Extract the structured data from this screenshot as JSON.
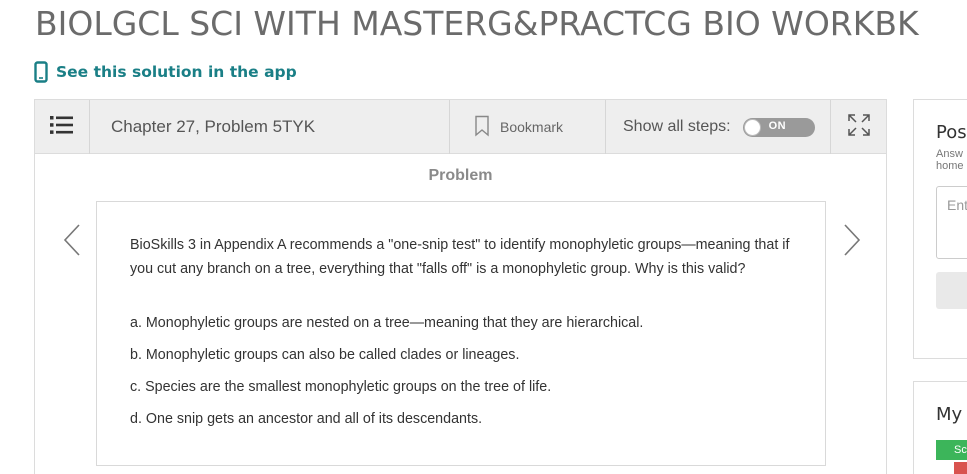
{
  "page": {
    "book_title": "BIOLGCL SCI WITH MASTERG&PRACTCG BIO WORKBK",
    "app_link_label": "See this solution in the app"
  },
  "toolbar": {
    "chapter_label": "Chapter 27, Problem 5TYK",
    "bookmark_label": "Bookmark",
    "show_steps_label": "Show all steps:",
    "toggle_state": "ON"
  },
  "problem": {
    "heading": "Problem",
    "question": "BioSkills 3 in Appendix A recommends a \"one-snip test\" to identify monophyletic groups—meaning that if you cut any branch on a tree, everything that \"falls off\" is a monophyletic group. Why is this valid?",
    "choices": [
      "a. Monophyletic groups are nested on a tree—meaning that they are hierarchical.",
      "b. Monophyletic groups can also be called clades or lineages.",
      "c. Species are the smallest monophyletic groups on the tree of life.",
      "d. One snip gets an ancestor and all of its descendants."
    ]
  },
  "sidebar": {
    "card1_title": "Pos",
    "card1_sub_line1": "Answ",
    "card1_sub_line2": "home",
    "card1_input_placeholder": "Ent",
    "card2_title": "My",
    "card2_badge": "Sc"
  },
  "colors": {
    "accent_teal": "#1a7f86",
    "toolbar_bg": "#eeeeee",
    "toggle_bg": "#9a9a9a",
    "badge_green": "#3cb55a",
    "badge_red": "#d9534f"
  },
  "icons": {
    "app": "phone-icon",
    "menu": "list-icon",
    "bookmark": "bookmark-icon",
    "expand": "expand-icon",
    "prev": "chevron-left-icon",
    "next": "chevron-right-icon"
  }
}
